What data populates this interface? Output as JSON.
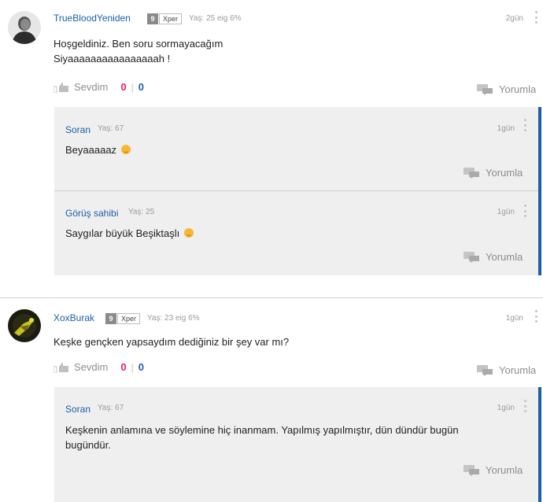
{
  "comments": [
    {
      "username": "TrueBloodYeniden",
      "level": "9",
      "badge": "Xper",
      "meta": "Yaş: 25 eig 6%",
      "time": "2gün",
      "text_line1": "Hoşgeldiniz. Ben soru sormayacağım",
      "text_line2": "Siyaaaaaaaaaaaaaaaah !",
      "like_label": "Sevdim",
      "likes": "0",
      "separator": "|",
      "dislikes": "0",
      "reply_label": "Yorumla",
      "replies": [
        {
          "username": "Soran",
          "meta": "Yaş: 67",
          "time": "1gün",
          "text": "Beyaaaaaz",
          "reply_label": "Yorumla"
        },
        {
          "username": "Görüş sahibi",
          "meta": "Yaş: 25",
          "time": "1gün",
          "text": "Saygılar büyük Beşiktaşlı",
          "reply_label": "Yorumla"
        }
      ]
    },
    {
      "username": "XoxBurak",
      "level": "9",
      "badge": "Xper",
      "meta": "Yaş: 23 eig 6%",
      "time": "1gün",
      "text_line1": "Keşke gençken yapsaydım dediğiniz bir şey var mı?",
      "like_label": "Sevdim",
      "likes": "0",
      "separator": "|",
      "dislikes": "0",
      "reply_label": "Yorumla",
      "replies": [
        {
          "username": "Soran",
          "meta": "Yaş: 67",
          "time": "1gün",
          "text_line1": "Keşkenin anlamına ve söylemine hiç inanmam. Yapılmış yapılmıştır, dün dündür bugün",
          "text_line2": "bugündür.",
          "reply_label": "Yorumla"
        }
      ]
    }
  ],
  "icons": {
    "thumb": "thumbs-up-icon",
    "reply": "chat-bubbles-icon",
    "menu": "kebab-menu-icon",
    "emoji": "smiley-emoji"
  },
  "colors": {
    "link": "#1c5ea8",
    "likes": "#e91e63",
    "reply_bg": "#efefef",
    "accent": "#1c5ea8"
  }
}
